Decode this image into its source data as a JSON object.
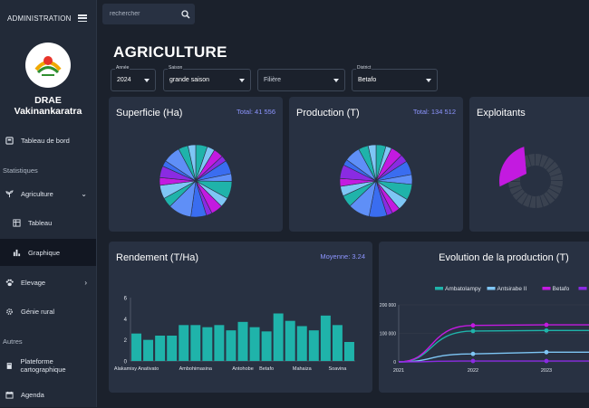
{
  "sidebar": {
    "header": "ADMINISTRATION",
    "org_name": "DRAE Vakinankaratra",
    "items": [
      {
        "label": "Tableau de bord"
      },
      {
        "label": "Agriculture"
      },
      {
        "label": "Tableau"
      },
      {
        "label": "Graphique"
      },
      {
        "label": "Elevage"
      },
      {
        "label": "Génie rural"
      },
      {
        "label": "Plateforme cartographique"
      },
      {
        "label": "Agenda"
      }
    ],
    "sections": {
      "stats": "Statistiques",
      "others": "Autres"
    }
  },
  "search": {
    "placeholder": "rechercher"
  },
  "page": {
    "title": "AGRICULTURE"
  },
  "filters": [
    {
      "label": "Année",
      "value": "2024"
    },
    {
      "label": "Saison",
      "value": "grande saison"
    },
    {
      "label": "",
      "value": "Filière"
    },
    {
      "label": "District",
      "value": "Betafo"
    }
  ],
  "cards": {
    "superficie": {
      "title": "Superficie (Ha)",
      "stat": "Total: 41 556"
    },
    "production": {
      "title": "Production (T)",
      "stat": "Total: 134 512"
    },
    "exploitants": {
      "title": "Exploitants"
    },
    "rendement": {
      "title": "Rendement (T/Ha)",
      "stat": "Moyenne: 3.24"
    },
    "evolution": {
      "title": "Evolution de la production (T)"
    }
  },
  "colors": {
    "teal": "#1fb3aa",
    "skyblue": "#7ec6f5",
    "magenta": "#c31ae0",
    "purple": "#8a2be2",
    "blue": "#3a6df0",
    "accent": "#8d95ff"
  },
  "pie_colors": [
    "#1fb3aa",
    "#7ec6f5",
    "#c31ae0",
    "#8a2be2",
    "#3a6df0",
    "#5f8ff7"
  ],
  "chart_data": [
    {
      "type": "pie",
      "title": "Superficie (Ha)",
      "values": [
        6,
        4,
        5,
        3,
        7,
        4,
        9,
        5,
        6,
        3,
        8,
        12,
        5,
        7,
        4,
        6,
        3,
        9,
        5,
        4
      ]
    },
    {
      "type": "pie",
      "title": "Production (T)",
      "values": [
        5,
        3,
        6,
        4,
        7,
        5,
        8,
        6,
        4,
        3,
        9,
        11,
        6,
        5,
        4,
        7,
        3,
        8,
        5,
        4
      ]
    },
    {
      "type": "pie",
      "title": "Exploitants",
      "values": [
        16,
        84
      ]
    },
    {
      "type": "bar",
      "title": "Rendement (T/Ha)",
      "categories": [
        "Alakamisy Anativato",
        "",
        "",
        "",
        "",
        "Ambohimasina",
        "",
        "",
        "",
        "Antohobe",
        "",
        "Betafo",
        "",
        "",
        "Mahaiza",
        "",
        "",
        "Soavina",
        ""
      ],
      "values": [
        2.6,
        2.0,
        2.4,
        2.4,
        3.4,
        3.4,
        3.2,
        3.4,
        2.9,
        3.7,
        3.2,
        2.8,
        4.5,
        3.8,
        3.3,
        2.9,
        4.3,
        3.4,
        1.8
      ],
      "ylim": [
        0,
        6
      ],
      "yticks": [
        "0",
        "2",
        "4",
        "6"
      ]
    },
    {
      "type": "line",
      "title": "Evolution de la production (T)",
      "x": [
        "2021",
        "2022",
        "2023"
      ],
      "yticks": [
        "0",
        "100 000",
        "200 000"
      ],
      "ylim": [
        0,
        200000
      ],
      "series": [
        {
          "name": "Ambatolampy",
          "values": [
            0,
            108000,
            110000
          ],
          "color": "#1fb3aa"
        },
        {
          "name": "Antsirabe II",
          "values": [
            0,
            28000,
            34000
          ],
          "color": "#7ec6f5"
        },
        {
          "name": "Betafo",
          "values": [
            0,
            128000,
            130000
          ],
          "color": "#c31ae0"
        },
        {
          "name": "Faratsiho",
          "values": [
            0,
            3000,
            3000
          ],
          "color": "#8a2be2"
        }
      ]
    }
  ]
}
